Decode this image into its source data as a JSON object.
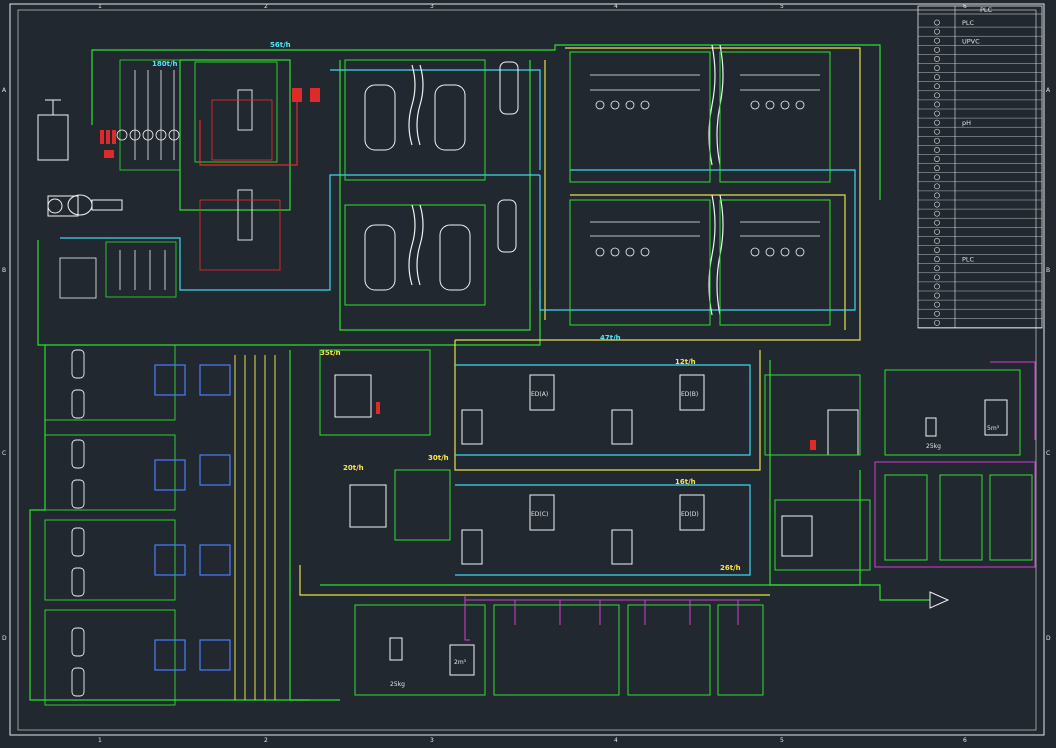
{
  "colors": {
    "background": "#212830",
    "frame": "#e6e6e6",
    "green": "#2ee02e",
    "yellow": "#e8e04a",
    "cyan": "#3cd6f0",
    "white": "#f2f2f2",
    "red": "#e02a2a",
    "magenta": "#d23cd2",
    "blue": "#4a7cff"
  },
  "grid": {
    "columns": [
      "1",
      "2",
      "3",
      "4",
      "5",
      "6"
    ],
    "rows": [
      "A",
      "B",
      "C",
      "D"
    ]
  },
  "flow_labels": {
    "top_main": "56t/h",
    "filter_left": "180t/h",
    "mid_main": "47t/h",
    "ro1": "35t/h",
    "ed_top": "12t/h",
    "ed_bottom": "16t/h",
    "ro2": "20t/h",
    "edi_water": "30t/h",
    "final": "26t/h"
  },
  "tank_labels": {
    "ro_tank_volume": "2m³",
    "right_tank_volume": "5m³",
    "ed_box_1": "ED(A)",
    "ed_box_2": "ED(B)",
    "ed_box_3": "ED(C)",
    "ed_box_4": "ED(D)",
    "ro_dose": "25kg",
    "right_dose": "25kg"
  },
  "legend": {
    "title": "PLC",
    "items": [
      "PLC",
      "",
      "UPVC",
      "",
      "",
      "",
      "",
      "",
      "",
      "",
      "",
      "pH",
      "",
      "",
      "",
      "",
      "",
      "",
      "",
      "",
      "",
      "",
      "",
      "",
      "",
      "",
      "PLC",
      "",
      "",
      "",
      "",
      "",
      "",
      ""
    ]
  }
}
